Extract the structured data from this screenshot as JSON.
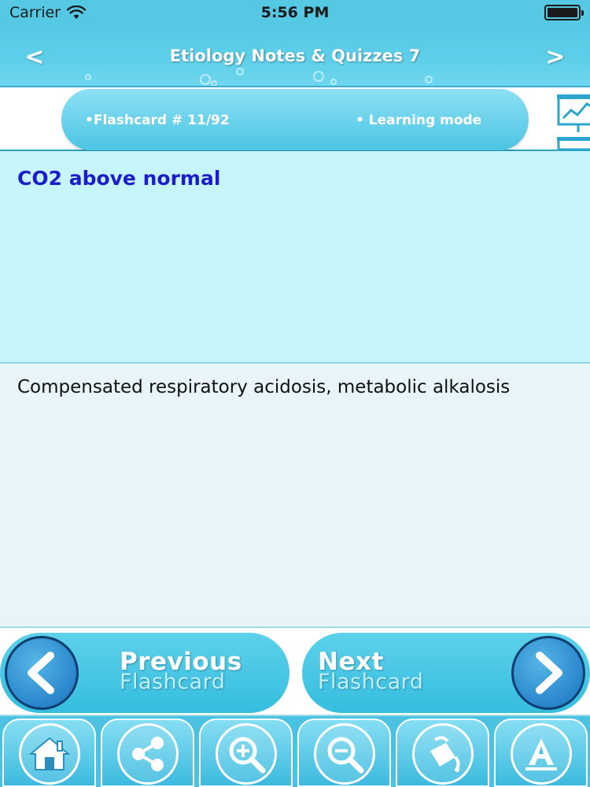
{
  "status_bar": {
    "carrier": "Carrier",
    "time": "5:56 PM"
  },
  "nav": {
    "title": "Etiology Notes & Quizzes 7",
    "back_label": "<",
    "forward_label": ">"
  },
  "info": {
    "counter": "•Flashcard #  11/92",
    "mode": "• Learning mode"
  },
  "card": {
    "question": "CO2 above normal",
    "answer": "Compensated respiratory acidosis, metabolic alkalosis"
  },
  "flash_nav": {
    "prev_big": "Previous",
    "prev_small": "Flashcard",
    "next_big": "Next",
    "next_small": "Flashcard"
  },
  "toolbar_icons": [
    "home-icon",
    "share-icon",
    "zoom-in-icon",
    "zoom-out-icon",
    "paint-bucket-icon",
    "font-icon"
  ],
  "colors": {
    "header": "#55c8e3",
    "question_bg": "#c6f6fb",
    "question_text": "#1c1ccc",
    "answer_bg": "#e9f4f8"
  }
}
